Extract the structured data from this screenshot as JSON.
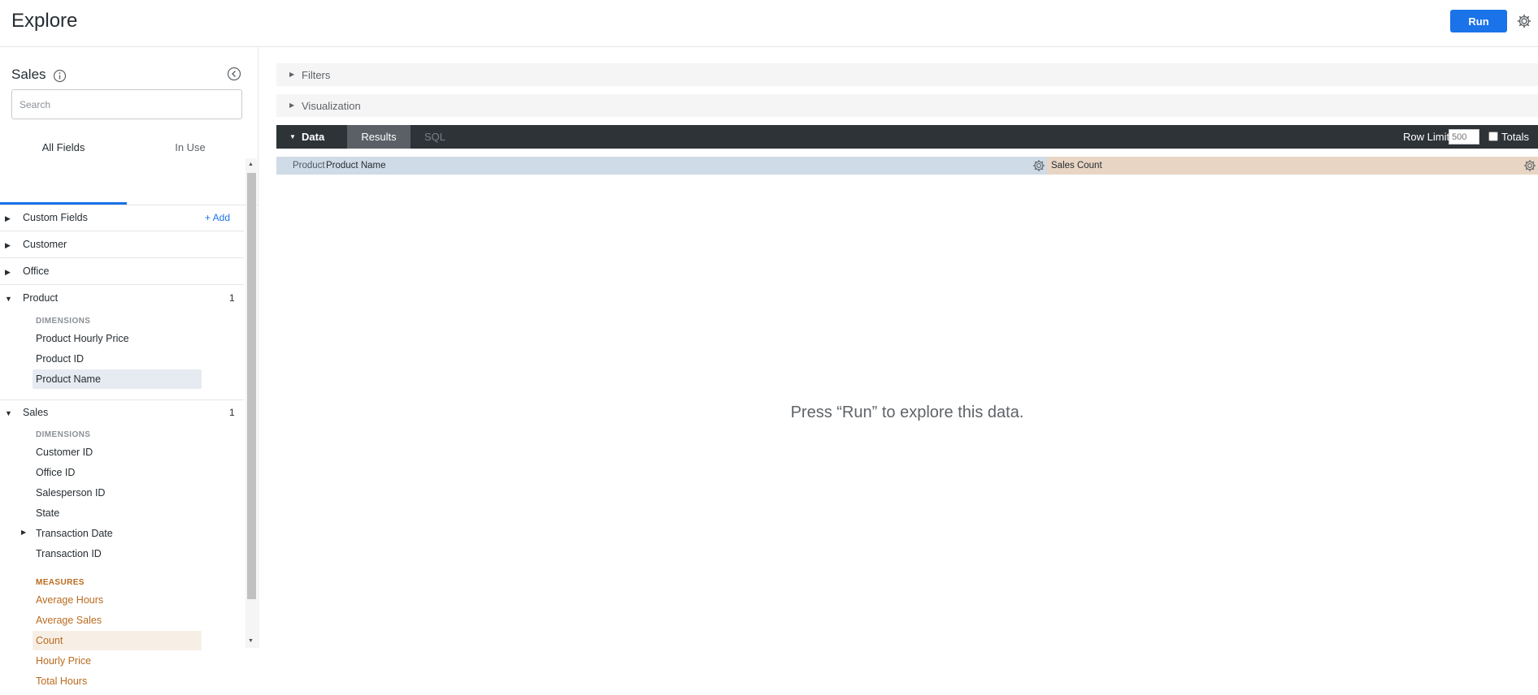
{
  "header": {
    "title": "Explore",
    "run_label": "Run"
  },
  "sidebar": {
    "model_title": "Sales",
    "search_placeholder": "Search",
    "tabs": {
      "all_fields": "All Fields",
      "in_use": "In Use"
    },
    "groups": {
      "custom_fields": {
        "label": "Custom Fields",
        "add_label": "+ Add"
      },
      "customer": {
        "label": "Customer"
      },
      "office": {
        "label": "Office"
      },
      "product": {
        "label": "Product",
        "count": "1",
        "dimensions_label": "DIMENSIONS",
        "fields": [
          "Product Hourly Price",
          "Product ID",
          "Product Name"
        ]
      },
      "sales": {
        "label": "Sales",
        "count": "1",
        "dimensions_label": "DIMENSIONS",
        "dimensions": [
          "Customer ID",
          "Office ID",
          "Salesperson ID",
          "State",
          "Transaction Date",
          "Transaction ID"
        ],
        "measures_label": "MEASURES",
        "measures": [
          "Average Hours",
          "Average Sales",
          "Count",
          "Hourly Price",
          "Total Hours"
        ]
      }
    }
  },
  "main": {
    "filters_label": "Filters",
    "visualization_label": "Visualization",
    "data_label": "Data",
    "results_label": "Results",
    "sql_label": "SQL",
    "row_limit_label": "Row Limit",
    "row_limit_value": "500",
    "totals_label": "Totals",
    "columns": {
      "dimension": {
        "view": "Product",
        "name": "Product Name"
      },
      "measure": {
        "label": "Sales Count"
      }
    },
    "empty_message": "Press “Run” to explore this data."
  },
  "colors": {
    "accent": "#1a73e8",
    "dimension": "#cfdbe6",
    "measure": "#e8d5c4",
    "measure_text": "#b96a1e",
    "data_bar": "#2e3338"
  },
  "icons": [
    "gear-icon",
    "info-icon",
    "collapse-left-icon",
    "caret-right-icon",
    "caret-down-icon"
  ]
}
